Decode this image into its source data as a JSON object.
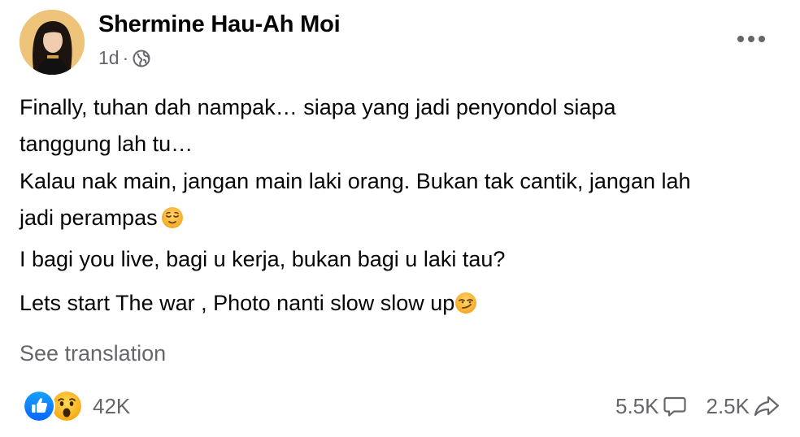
{
  "post": {
    "author_name": "Shermine Hau-Ah Moi",
    "time": "1d",
    "separator": "·",
    "audience_icon": "globe-icon",
    "more_icon": "more-horizontal-icon",
    "paragraphs": [
      {
        "lines": [
          "Finally, tuhan dah nampak… siapa yang jadi penyondol siapa",
          "tanggung lah tu…"
        ]
      },
      {
        "lines": [
          "Kalau nak main, jangan main laki orang. Bukan tak cantik, jangan lah",
          "jadi perampas"
        ],
        "emoji": "relieved-face-emoji"
      },
      {
        "lines": [
          "I bagi you live, bagi u kerja, bukan bagi u laki tau?"
        ]
      },
      {
        "lines": [
          "Lets start The war , Photo nanti slow slow up"
        ],
        "emoji": "smirking-face-emoji"
      }
    ],
    "see_translation": "See translation",
    "reactions": {
      "icons": [
        "like-reaction-icon",
        "wow-reaction-icon"
      ],
      "count": "42K"
    },
    "comments_count": "5.5K",
    "comments_icon": "comment-icon",
    "shares_count": "2.5K",
    "shares_icon": "share-icon"
  },
  "colors": {
    "text": "#050505",
    "secondary_text": "#65676b",
    "like_blue": "#1877f2",
    "wow_yellow": "#f7b125"
  }
}
